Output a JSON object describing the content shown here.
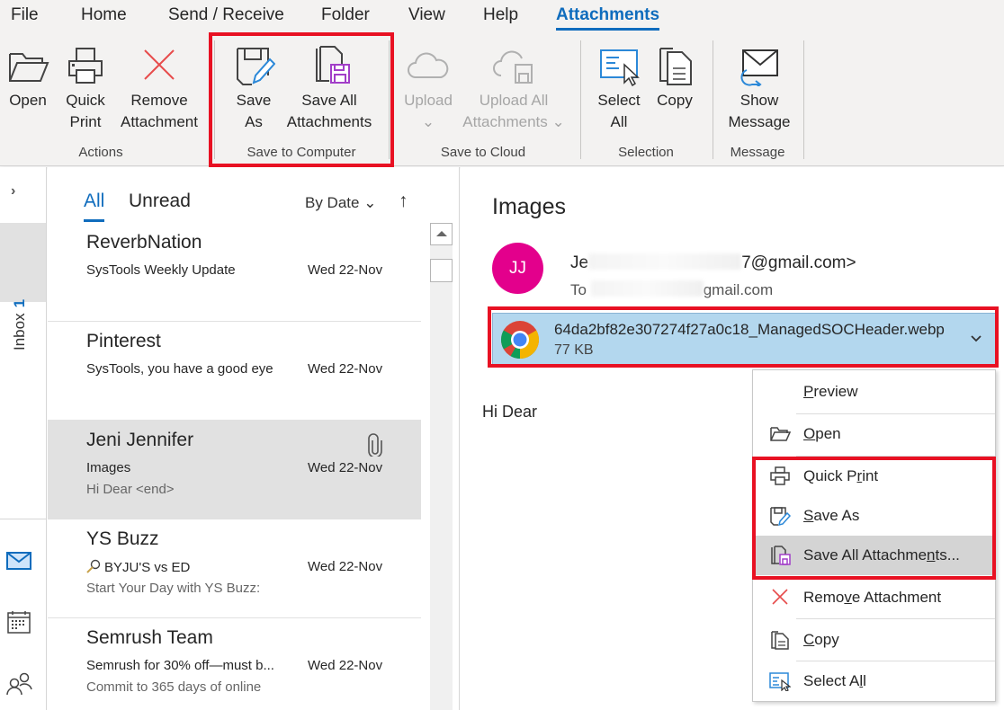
{
  "ribbon": {
    "tabs": [
      {
        "label": "File"
      },
      {
        "label": "Home"
      },
      {
        "label": "Send / Receive"
      },
      {
        "label": "Folder"
      },
      {
        "label": "View"
      },
      {
        "label": "Help"
      },
      {
        "label": "Attachments",
        "active": true
      }
    ],
    "groups": {
      "actions": {
        "label": "Actions",
        "buttons": {
          "open": {
            "line1": "Open",
            "line2": "",
            "icon": "folder-open-icon"
          },
          "quick_print": {
            "line1": "Quick",
            "line2": "Print",
            "icon": "printer-icon"
          },
          "remove": {
            "line1": "Remove",
            "line2": "Attachment",
            "icon": "red-x-icon"
          }
        }
      },
      "save_to_computer": {
        "label": "Save to Computer",
        "highlighted": true,
        "buttons": {
          "save_as": {
            "line1": "Save",
            "line2": "As",
            "icon": "save-as-icon"
          },
          "save_all": {
            "line1": "Save All",
            "line2": "Attachments",
            "icon": "save-all-icon"
          }
        }
      },
      "save_to_cloud": {
        "label": "Save to Cloud",
        "buttons": {
          "upload": {
            "line1": "Upload",
            "line2": "⌄",
            "icon": "cloud-icon",
            "disabled": true
          },
          "upload_all": {
            "line1": "Upload All",
            "line2": "Attachments ⌄",
            "icon": "cloud-save-icon",
            "disabled": true
          }
        }
      },
      "selection": {
        "label": "Selection",
        "buttons": {
          "select_all": {
            "line1": "Select",
            "line2": "All",
            "icon": "select-all-icon"
          },
          "copy": {
            "line1": "Copy",
            "line2": "",
            "icon": "copy-icon"
          }
        }
      },
      "message": {
        "label": "Message",
        "buttons": {
          "show_message": {
            "line1": "Show",
            "line2": "Message",
            "icon": "envelope-return-icon"
          }
        }
      }
    }
  },
  "nav": {
    "expand_glyph": "›",
    "inbox_label": "Inbox",
    "inbox_count": "1"
  },
  "list": {
    "filters": [
      {
        "label": "All",
        "active": true
      },
      {
        "label": "Unread"
      }
    ],
    "sort_label": "By Date ⌄",
    "sort_direction": "↑",
    "messages": [
      {
        "sender": "ReverbNation",
        "subject": "SysTools Weekly Update",
        "date": "Wed 22-Nov",
        "preview": ""
      },
      {
        "sender": "Pinterest",
        "subject": "SysTools, you have a good eye",
        "date": "Wed 22-Nov",
        "preview": ""
      },
      {
        "sender": "Jeni Jennifer",
        "subject": "Images",
        "date": "Wed 22-Nov",
        "preview": "Hi Dear <end>",
        "has_attachment": true,
        "selected": true
      },
      {
        "sender": "YS Buzz",
        "subject": "BYJU'S vs ED",
        "date": "Wed 22-Nov",
        "preview": "Start Your Day with YS Buzz:",
        "subject_icon": "search-key-icon"
      },
      {
        "sender": "Semrush Team",
        "subject": "Semrush for 30% off—must b...",
        "date": "Wed 22-Nov",
        "preview": "Commit to 365 days of online"
      }
    ]
  },
  "reading": {
    "subject": "Images",
    "avatar_initials": "JJ",
    "avatar_color": "#e3008c",
    "from_prefix": "Je",
    "from_suffix": "7@gmail.com>",
    "to_prefix": "To",
    "to_suffix": "gmail.com",
    "attachment": {
      "name": "64da2bf82e307274f27a0c18_ManagedSOCHeader.webp",
      "size": "77 KB",
      "icon": "chrome-icon"
    },
    "body": "Hi Dear"
  },
  "context_menu": {
    "items": [
      {
        "label_pre": "",
        "label_u": "P",
        "label_post": "review",
        "icon": ""
      },
      {
        "label_pre": "",
        "label_u": "O",
        "label_post": "pen",
        "icon": "folder-open-icon"
      },
      {
        "label_pre": "Quick P",
        "label_u": "r",
        "label_post": "int",
        "icon": "printer-icon",
        "highlighted_group": true
      },
      {
        "label_pre": "",
        "label_u": "S",
        "label_post": "ave As",
        "icon": "save-as-icon",
        "highlighted_group": true
      },
      {
        "label_pre": "Save All Attachme",
        "label_u": "n",
        "label_post": "ts...",
        "icon": "save-all-icon",
        "highlighted_group": true,
        "hover": true
      },
      {
        "label_pre": "Remo",
        "label_u": "v",
        "label_post": "e Attachment",
        "icon": "red-x-icon"
      },
      {
        "label_pre": "",
        "label_u": "C",
        "label_post": "opy",
        "icon": "copy-icon"
      },
      {
        "label_pre": "Select A",
        "label_u": "l",
        "label_post": "l",
        "icon": "select-all-icon"
      }
    ]
  },
  "colors": {
    "accent": "#0f6cbd",
    "highlight_box": "#e81123",
    "attachment_bg": "#b3d7ee",
    "selected_row": "#e1e1e1"
  }
}
